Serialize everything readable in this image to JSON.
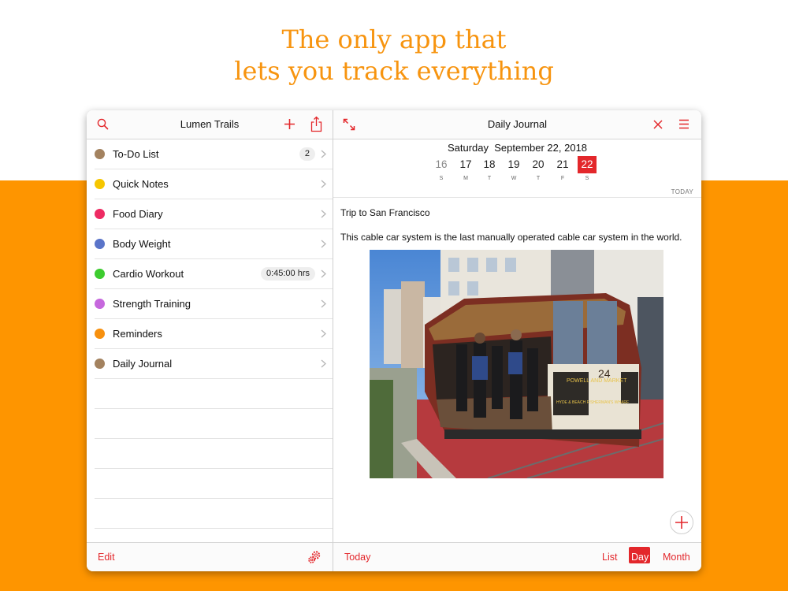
{
  "headline": {
    "line1": "The only app that",
    "line2": "lets you track everything"
  },
  "colors": {
    "accent": "#e3272b",
    "background_band": "#fe9500",
    "headline": "#f7940f"
  },
  "left_panel": {
    "title": "Lumen Trails",
    "icons": [
      "search-icon",
      "plus-icon",
      "share-icon"
    ],
    "items": [
      {
        "label": "To-Do List",
        "dot_color": "#a3825f",
        "badge": "2"
      },
      {
        "label": "Quick Notes",
        "dot_color": "#f6c600",
        "badge": ""
      },
      {
        "label": "Food Diary",
        "dot_color": "#ee2b63",
        "badge": ""
      },
      {
        "label": "Body Weight",
        "dot_color": "#5a74c9",
        "badge": ""
      },
      {
        "label": "Cardio Workout",
        "dot_color": "#3dcc2f",
        "badge": "0:45:00 hrs"
      },
      {
        "label": "Strength Training",
        "dot_color": "#c668dd",
        "badge": ""
      },
      {
        "label": "Reminders",
        "dot_color": "#f7900e",
        "badge": ""
      },
      {
        "label": "Daily Journal",
        "dot_color": "#a3825f",
        "badge": ""
      }
    ],
    "toolbar": {
      "edit_label": "Edit",
      "settings_icon": "gear-icon"
    }
  },
  "right_panel": {
    "title": "Daily Journal",
    "icons": [
      "expand-icon",
      "close-icon",
      "menu-icon"
    ],
    "date_heading": "Saturday  September 22, 2018",
    "week": [
      {
        "num": "16",
        "wd": "S"
      },
      {
        "num": "17",
        "wd": "M"
      },
      {
        "num": "18",
        "wd": "T"
      },
      {
        "num": "19",
        "wd": "W"
      },
      {
        "num": "20",
        "wd": "T"
      },
      {
        "num": "21",
        "wd": "F"
      },
      {
        "num": "22",
        "wd": "S"
      }
    ],
    "selected_day": "22",
    "today_label": "TODAY",
    "entry": {
      "title": "Trip to San Francisco",
      "body": "This cable car system is the last manually operated cable car system in the world.",
      "photo_sign_1": "POWELL AND MARKET",
      "photo_sign_2": "HYDE & BEACH FISHERMAN'S WHARF",
      "photo_number": "24"
    },
    "toolbar": {
      "today_label": "Today",
      "list_label": "List",
      "day_label": "Day",
      "month_label": "Month"
    }
  }
}
